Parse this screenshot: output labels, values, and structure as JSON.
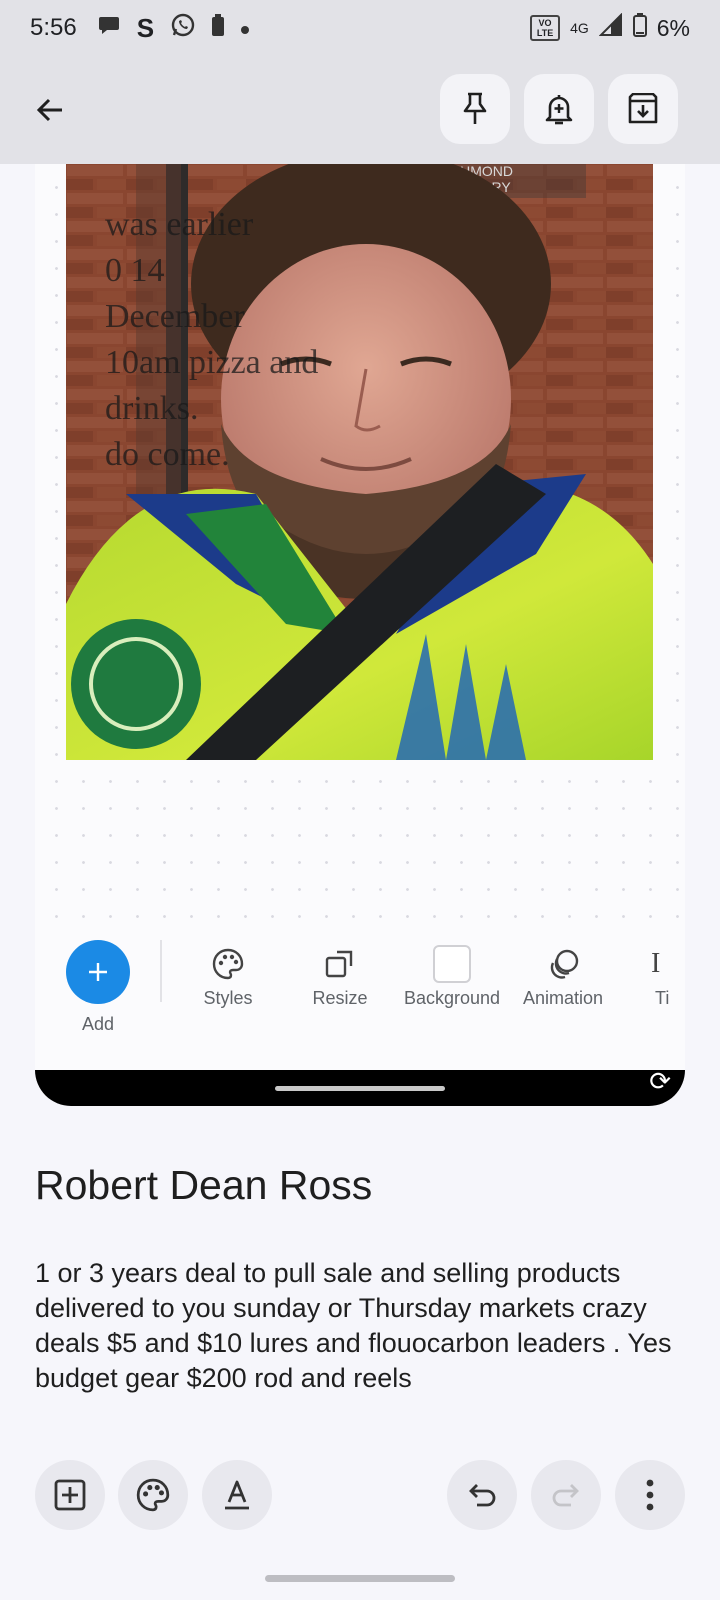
{
  "status_bar": {
    "time": "5:56",
    "battery_percent": "6%",
    "network": "4G",
    "volte_label": "VO LTE",
    "left_icons": [
      "chat-bubble-icon",
      "s-app-icon",
      "whatsapp-icon",
      "battery-small-icon",
      "dot-icon"
    ],
    "right_icons": [
      "volte-icon",
      "signal-icon",
      "battery-icon"
    ]
  },
  "app_bar": {
    "back_icon": "arrow-left-icon",
    "actions": [
      {
        "name": "pin",
        "icon": "pin-icon"
      },
      {
        "name": "reminder",
        "icon": "bell-plus-icon"
      },
      {
        "name": "archive",
        "icon": "archive-icon"
      }
    ]
  },
  "canvas": {
    "overlay_text": "was earlier\n0 14\nDecember\n10am pizza and\ndrinks.\ndo come.",
    "photo_sign_text": "RICHMOND\nLIBRARY",
    "toolbar": {
      "add_label": "Add",
      "tools": [
        {
          "label": "Styles",
          "icon": "palette-icon"
        },
        {
          "label": "Resize",
          "icon": "resize-icon"
        },
        {
          "label": "Background",
          "icon": "white-square-icon"
        },
        {
          "label": "Animation",
          "icon": "animation-icon"
        },
        {
          "label": "Ti",
          "icon": "text-icon"
        }
      ]
    }
  },
  "note": {
    "title": "Robert Dean Ross",
    "body": "1 or 3 years deal to pull sale and selling products delivered to you sunday or Thursday markets crazy deals $5 and $10 lures and flouocarbon leaders . Yes budget gear $200 rod and reels"
  },
  "bottom_bar": {
    "left_actions": [
      "add-box-icon",
      "palette-icon",
      "text-format-icon"
    ],
    "right_actions": [
      "undo-icon",
      "redo-icon",
      "more-vert-icon"
    ]
  },
  "colors": {
    "accent": "#1b8ae5",
    "app_bar_bg": "#e2e2e7",
    "page_bg": "#f6f6fb"
  }
}
